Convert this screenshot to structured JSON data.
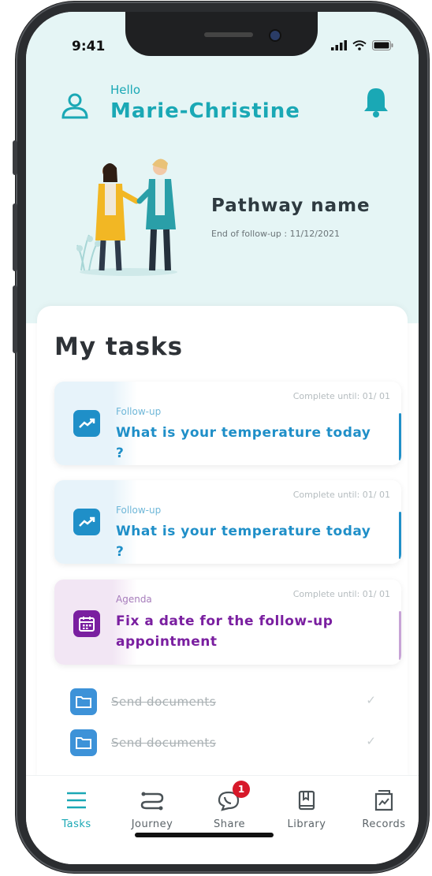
{
  "status_bar": {
    "time": "9:41"
  },
  "header": {
    "greeting": "Hello",
    "user_name": "Marie-Christine",
    "pathway_name": "Pathway name",
    "end_of_followup": "End of follow-up : 11/12/2021"
  },
  "tasks_section": {
    "title": "My tasks",
    "tasks": [
      {
        "category": "Follow-up",
        "title": "What is your temperature today ?",
        "due": "Complete until: 01/ 01",
        "icon": "chart-up-icon",
        "color": "#1f8fc8"
      },
      {
        "category": "Follow-up",
        "title": "What is your temperature today ?",
        "due": "Complete until: 01/ 01",
        "icon": "chart-up-icon",
        "color": "#1f8fc8"
      },
      {
        "category": "Agenda",
        "title": "Fix a date for the follow-up appointment",
        "due": "Complete until: 01/ 01",
        "icon": "calendar-icon",
        "color": "#7a1fa0"
      }
    ],
    "completed": [
      {
        "label": "Send documents",
        "icon": "folder-icon"
      },
      {
        "label": "Send documents",
        "icon": "folder-icon"
      }
    ]
  },
  "tab_bar": {
    "tabs": [
      {
        "label": "Tasks",
        "icon": "list-icon",
        "active": true
      },
      {
        "label": "Journey",
        "icon": "route-icon"
      },
      {
        "label": "Share",
        "icon": "chat-phone-icon",
        "badge": "1"
      },
      {
        "label": "Library",
        "icon": "book-icon"
      },
      {
        "label": "Records",
        "icon": "records-icon"
      }
    ]
  },
  "colors": {
    "accent": "#1aa8b5",
    "header_bg": "#e5f5f5",
    "badge": "#d7192a"
  }
}
